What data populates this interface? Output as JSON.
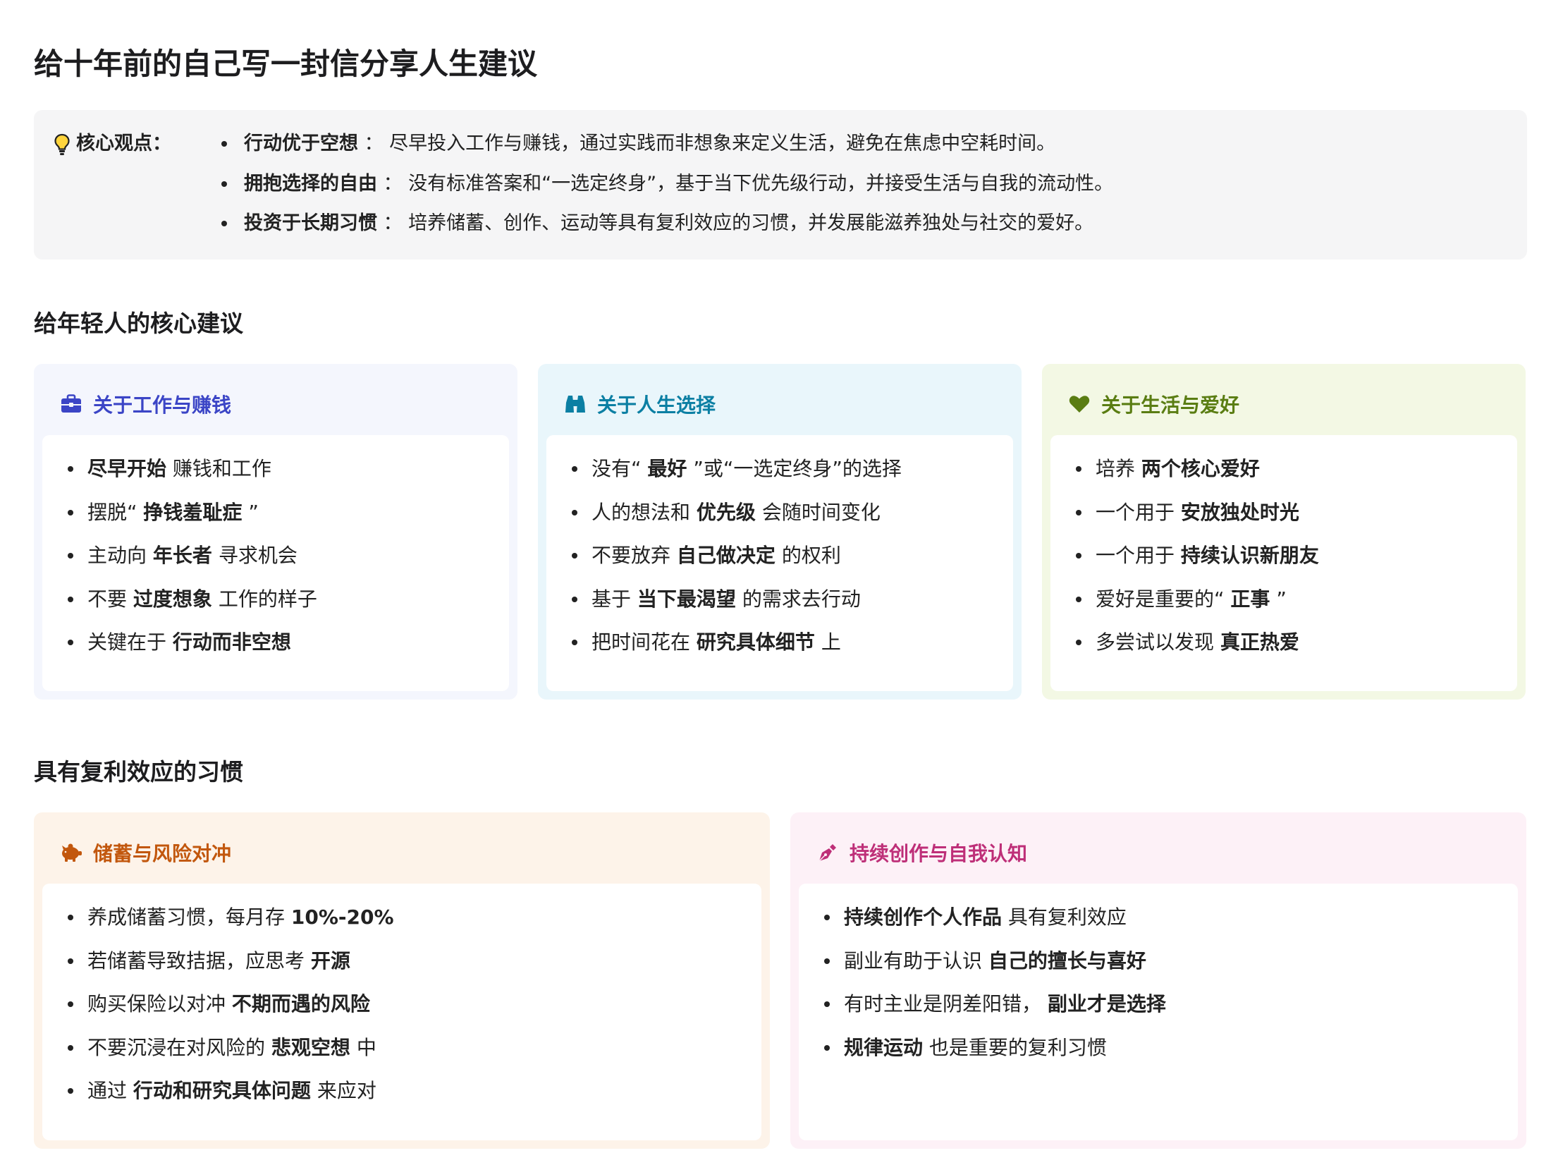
{
  "title": "给十年前的自己写一封信分享人生建议",
  "summary": {
    "label": "核心观点：",
    "icon": "lightbulb-icon",
    "points": [
      {
        "term": "行动优于空想",
        "sep": "：",
        "text": "尽早投入工作与赚钱，通过实践而非想象来定义生活，避免在焦虑中空耗时间。"
      },
      {
        "term": "拥抱选择的自由",
        "sep": "：",
        "text": "没有标准答案和“一选定终身”，基于当下优先级行动，并接受生活与自我的流动性。"
      },
      {
        "term": "投资于长期习惯",
        "sep": "：",
        "text": "培养储蓄、创作、运动等具有复利效应的习惯，并发展能滋养独处与社交的爱好。"
      }
    ]
  },
  "section1": {
    "title": "给年轻人的核心建议",
    "cards": [
      {
        "title": "关于工作与赚钱",
        "icon": "briefcase-icon",
        "color": "#3b45c6",
        "items": [
          [
            {
              "t": "尽早开始",
              "b": true
            },
            {
              "t": " 赚钱和工作"
            }
          ],
          [
            {
              "t": "摆脱“ "
            },
            {
              "t": "挣钱羞耻症",
              "b": true
            },
            {
              "t": " ”"
            }
          ],
          [
            {
              "t": "主动向 "
            },
            {
              "t": "年长者",
              "b": true
            },
            {
              "t": " 寻求机会"
            }
          ],
          [
            {
              "t": "不要 "
            },
            {
              "t": "过度想象",
              "b": true
            },
            {
              "t": " 工作的样子"
            }
          ],
          [
            {
              "t": "关键在于 "
            },
            {
              "t": "行动而非空想",
              "b": true
            }
          ]
        ]
      },
      {
        "title": "关于人生选择",
        "icon": "binoculars-icon",
        "color": "#0b7fa3",
        "items": [
          [
            {
              "t": "没有“ "
            },
            {
              "t": "最好",
              "b": true
            },
            {
              "t": " ”或“一选定终身”的选择"
            }
          ],
          [
            {
              "t": "人的想法和 "
            },
            {
              "t": "优先级",
              "b": true
            },
            {
              "t": " 会随时间变化"
            }
          ],
          [
            {
              "t": "不要放弃 "
            },
            {
              "t": "自己做决定",
              "b": true
            },
            {
              "t": " 的权利"
            }
          ],
          [
            {
              "t": "基于 "
            },
            {
              "t": "当下最渴望",
              "b": true
            },
            {
              "t": " 的需求去行动"
            }
          ],
          [
            {
              "t": "把时间花在 "
            },
            {
              "t": "研究具体细节",
              "b": true
            },
            {
              "t": " 上"
            }
          ]
        ]
      },
      {
        "title": "关于生活与爱好",
        "icon": "heart-icon",
        "color": "#5a7d12",
        "items": [
          [
            {
              "t": "培养 "
            },
            {
              "t": "两个核心爱好",
              "b": true
            }
          ],
          [
            {
              "t": "一个用于 "
            },
            {
              "t": "安放独处时光",
              "b": true
            }
          ],
          [
            {
              "t": "一个用于 "
            },
            {
              "t": "持续认识新朋友",
              "b": true
            }
          ],
          [
            {
              "t": "爱好是重要的“ "
            },
            {
              "t": "正事",
              "b": true
            },
            {
              "t": " ”"
            }
          ],
          [
            {
              "t": "多尝试以发现 "
            },
            {
              "t": "真正热爱",
              "b": true
            }
          ]
        ]
      }
    ]
  },
  "section2": {
    "title": "具有复利效应的习惯",
    "cards": [
      {
        "title": "储蓄与风险对冲",
        "icon": "piggy-bank-icon",
        "color": "#c2570d",
        "items": [
          [
            {
              "t": "养成储蓄习惯，每月存 "
            },
            {
              "t": "10%-20%",
              "b": true
            }
          ],
          [
            {
              "t": "若储蓄导致拮据，应思考 "
            },
            {
              "t": "开源",
              "b": true
            }
          ],
          [
            {
              "t": "购买保险以对冲 "
            },
            {
              "t": "不期而遇的风险",
              "b": true
            }
          ],
          [
            {
              "t": "不要沉浸在对风险的 "
            },
            {
              "t": "悲观空想",
              "b": true
            },
            {
              "t": " 中"
            }
          ],
          [
            {
              "t": "通过 "
            },
            {
              "t": "行动和研究具体问题",
              "b": true
            },
            {
              "t": " 来应对"
            }
          ]
        ]
      },
      {
        "title": "持续创作与自我认知",
        "icon": "pen-nib-icon",
        "color": "#be2f78",
        "items": [
          [
            {
              "t": "持续创作个人作品",
              "b": true
            },
            {
              "t": " 具有复利效应"
            }
          ],
          [
            {
              "t": "副业有助于认识 "
            },
            {
              "t": "自己的擅长与喜好",
              "b": true
            }
          ],
          [
            {
              "t": "有时主业是阴差阳错， "
            },
            {
              "t": "副业才是选择",
              "b": true
            }
          ],
          [
            {
              "t": "规律运动",
              "b": true
            },
            {
              "t": " 也是重要的复利习惯"
            }
          ]
        ]
      }
    ]
  }
}
